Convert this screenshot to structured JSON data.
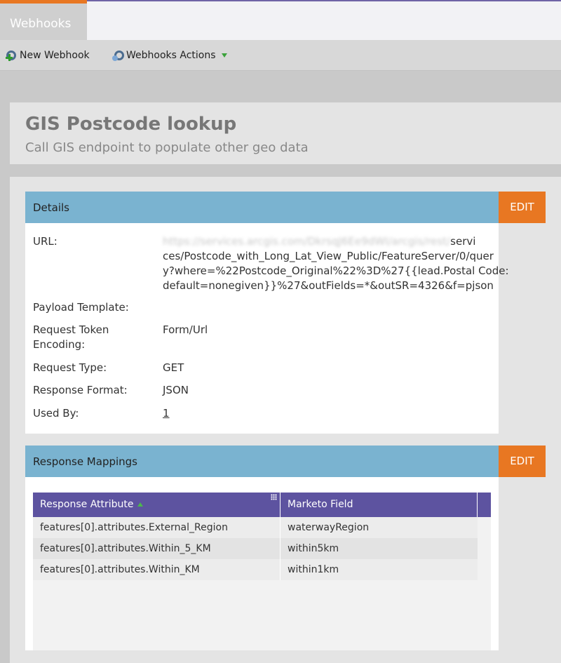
{
  "tab": {
    "label": "Webhooks"
  },
  "toolbar": {
    "new_label": "New Webhook",
    "actions_label": "Webhooks Actions"
  },
  "header": {
    "title": "GIS Postcode lookup",
    "subtitle": "Call GIS endpoint to populate other geo data"
  },
  "details": {
    "title": "Details",
    "edit_label": "EDIT",
    "url_label": "URL:",
    "url_line1_visible": "servi",
    "url_line2": "ces/Postcode_with_Long_Lat_View_Public/FeatureServer/0/quer",
    "url_line3": "y?where=%22Postcode_Original%22%3D%27{{lead.Postal Code:",
    "url_line4": "default=nonegiven}}%27&outFields=*&outSR=4326&f=pjson",
    "payload_label": "Payload Template:",
    "token_label_1": "Request Token",
    "token_label_2": "Encoding:",
    "token_value": "Form/Url",
    "type_label": "Request Type:",
    "type_value": "GET",
    "format_label": "Response Format:",
    "format_value": "JSON",
    "used_label": "Used By:",
    "used_value": "1"
  },
  "mappings": {
    "title": "Response Mappings",
    "edit_label": "EDIT",
    "columns": [
      "Response Attribute",
      "Marketo Field"
    ],
    "rows": [
      {
        "attribute": "features[0].attributes.External_Region",
        "field": "waterwayRegion"
      },
      {
        "attribute": "features[0].attributes.Within_5_KM",
        "field": "within5km"
      },
      {
        "attribute": "features[0].attributes.Within_KM",
        "field": "within1km"
      }
    ]
  },
  "colors": {
    "accent_orange": "#e87722",
    "panel_blue": "#7ab3d0",
    "grid_header_purple": "#5d53a0"
  }
}
